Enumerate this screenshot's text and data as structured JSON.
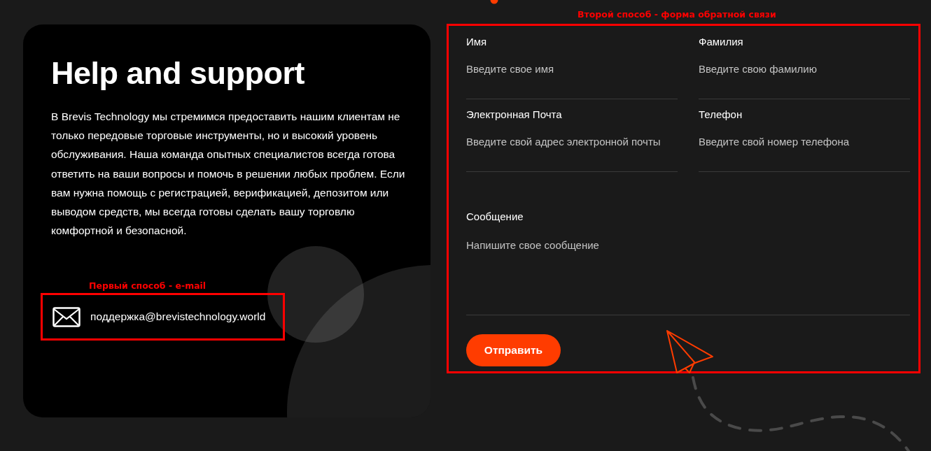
{
  "support_card": {
    "title": "Help and support",
    "description": "В Brevis Technology мы стремимся предоставить нашим клиентам не только передовые торговые инструменты, но и высокий уровень обслуживания. Наша команда опытных специалистов всегда готова ответить на ваши вопросы и помочь в решении любых проблем. Если вам нужна помощь с регистрацией, верификацией, депозитом или выводом средств, мы всегда готовы сделать вашу торговлю комфортной и безопасной.",
    "email_annotation": "Первый способ - e-mail",
    "email": "поддержка@brevistechnology.world"
  },
  "contact_form": {
    "annotation": "Второй способ - форма обратной связи",
    "fields": [
      {
        "kind": "input",
        "label": "Имя",
        "placeholder": "Введите свое имя"
      },
      {
        "kind": "input",
        "label": "Фамилия",
        "placeholder": "Введите свою фамилию"
      },
      {
        "kind": "input",
        "label": "Электронная Почта",
        "placeholder": "Введите свой адрес электронной почты"
      },
      {
        "kind": "input",
        "label": "Телефон",
        "placeholder": "Введите свой номер телефона"
      },
      {
        "kind": "textarea",
        "label": "Сообщение",
        "placeholder": "Напишите свое сообщение"
      }
    ],
    "submit": "Отправить"
  }
}
